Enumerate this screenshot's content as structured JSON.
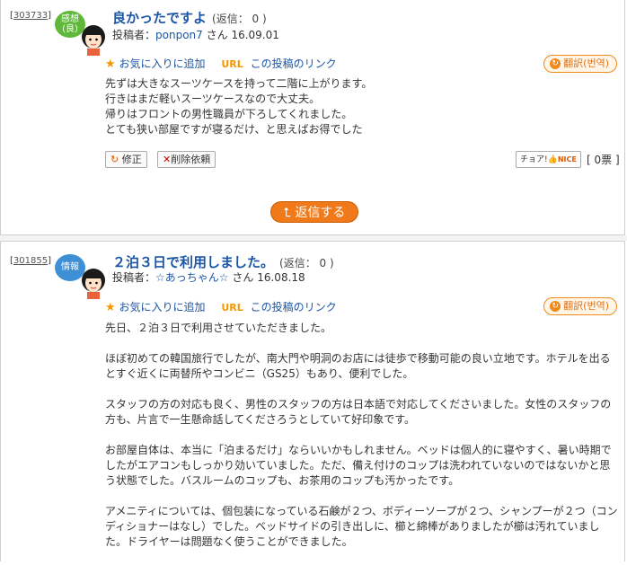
{
  "post1": {
    "id": "303733",
    "badge": "感想\n(良)",
    "title": "良かったですよ",
    "reply_label": "(返信：",
    "reply_count": "0",
    "reply_close": ")",
    "author_label": "投稿者：",
    "author_name": "ponpon7",
    "author_suffix": "さん",
    "date": "16.09.01",
    "favorite": "お気に入りに追加",
    "url_label": "URL",
    "link": "この投稿のリンク",
    "translate": "翻訳(번역)",
    "body": [
      "先ずは大きなスーツケースを持って二階に上がります。",
      "行きはまだ軽いスーツケースなので大丈夫。",
      "帰りはフロントの男性職員が下ろしてくれました。",
      "とても狭い部屋ですが寝るだけ、と思えばお得でした"
    ],
    "edit": "修正",
    "delete": "削除依頼",
    "nice_label": "チョア!",
    "nice_badge": "NICE",
    "votes": "[ 0票 ]",
    "reply_button": "返信する"
  },
  "post2": {
    "id": "301855",
    "badge": "情報",
    "title": "２泊３日で利用しました。",
    "reply_label": "(返信：",
    "reply_count": "0",
    "reply_close": ")",
    "author_label": "投稿者：",
    "author_name": "☆あっちゃん☆",
    "author_suffix": "さん",
    "date": "16.08.18",
    "favorite": "お気に入りに追加",
    "url_label": "URL",
    "link": "この投稿のリンク",
    "translate": "翻訳(번역)",
    "body": [
      "先日、２泊３日で利用させていただきました。",
      "ほぼ初めての韓国旅行でしたが、南大門や明洞のお店には徒歩で移動可能の良い立地です。ホテルを出るとすぐ近くに両替所やコンビニ（GS25）もあり、便利でした。",
      "スタッフの方の対応も良く、男性のスタッフの方は日本語で対応してくださいました。女性のスタッフの方も、片言で一生懸命話してくださろうとしていて好印象です。",
      "お部屋自体は、本当に「泊まるだけ」ならいいかもしれません。ベッドは個人的に寝やすく、暑い時期でしたがエアコンもしっかり効いていました。ただ、備え付けのコップは洗われていないのではないかと思う状態でした。バスルームのコップも、お茶用のコップも汚かったです。",
      "アメニティについては、個包装になっている石鹸が２つ、ボディーソープが２つ、シャンプーが２つ（コンディショナーはなし）でした。ベッドサイドの引き出しに、櫛と綿棒がありましたが櫛は汚れていました。ドライヤーは問題なく使うことができました。"
    ]
  }
}
